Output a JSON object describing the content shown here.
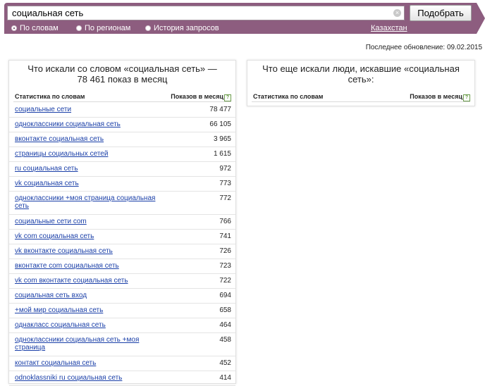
{
  "search": {
    "query": "социальная сеть",
    "clear_glyph": "×",
    "submit_label": "Подобрать"
  },
  "modes": [
    {
      "label": "По словам",
      "selected": true
    },
    {
      "label": "По регионам",
      "selected": false
    },
    {
      "label": "История запросов",
      "selected": false
    }
  ],
  "region": "Казахстан",
  "last_update": "Последнее обновление: 09.02.2015",
  "left_panel": {
    "title": "Что искали со словом «социальная сеть» — 78 461 показ в месяц",
    "col_query": "Статистика по словам",
    "col_count": "Показов в месяц",
    "help_glyph": "?",
    "rows": [
      {
        "query": "социальные сети",
        "count": "78 477"
      },
      {
        "query": "одноклассники социальная сеть",
        "count": "66 105"
      },
      {
        "query": "вконтакте социальная сеть",
        "count": "3 965"
      },
      {
        "query": "страницы социальных сетей",
        "count": "1 615"
      },
      {
        "query": "ru социальная сеть",
        "count": "972"
      },
      {
        "query": "vk социальная сеть",
        "count": "773"
      },
      {
        "query": "одноклассники +моя страница социальная сеть",
        "count": "772"
      },
      {
        "query": "социальные сети com",
        "count": "766"
      },
      {
        "query": "vk com социальная сеть",
        "count": "741"
      },
      {
        "query": "vk вконтакте социальная сеть",
        "count": "726"
      },
      {
        "query": "вконтакте com социальная сеть",
        "count": "723"
      },
      {
        "query": "vk com вконтакте социальная сеть",
        "count": "722"
      },
      {
        "query": "социальная сеть вход",
        "count": "694"
      },
      {
        "query": "+мой мир социальная сеть",
        "count": "658"
      },
      {
        "query": "однакласс социальная сеть",
        "count": "464"
      },
      {
        "query": "одноклассники социальная сеть +моя страница",
        "count": "458"
      },
      {
        "query": "контакт социальная сеть",
        "count": "452"
      },
      {
        "query": "odnoklassniki ru социальная сеть",
        "count": "414"
      }
    ]
  },
  "right_panel": {
    "title": "Что еще искали люди, искавшие «социальная сеть»:",
    "col_query": "Статистика по словам",
    "col_count": "Показов в месяц",
    "help_glyph": "?"
  }
}
